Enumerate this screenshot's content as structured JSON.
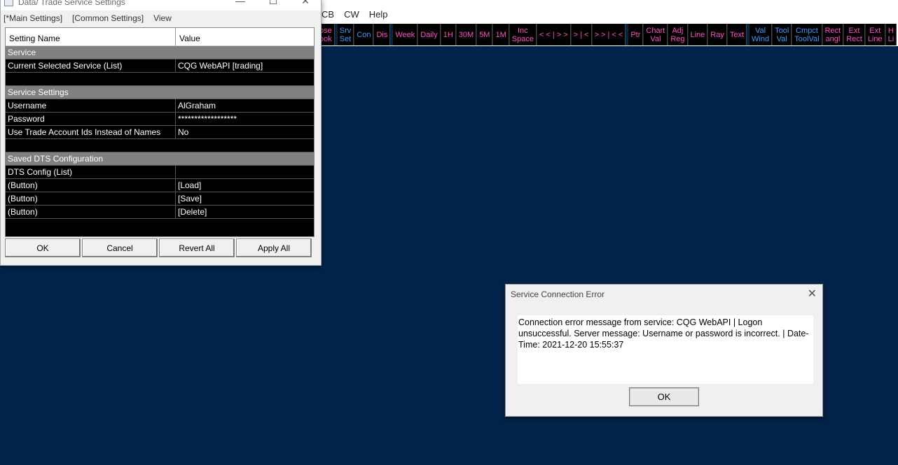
{
  "app": {
    "menu": [
      "CB",
      "CW",
      "Help"
    ],
    "toolbar": [
      {
        "label": "ose\nook",
        "color": "pink"
      },
      {
        "label": "Srv\nSet",
        "color": "blue"
      },
      {
        "label": "Con",
        "color": "blue"
      },
      {
        "label": "Dis",
        "color": "pink"
      },
      {
        "label": "Week",
        "color": "pink"
      },
      {
        "label": "Daily",
        "color": "pink"
      },
      {
        "label": "1H",
        "color": "pink"
      },
      {
        "label": "30M",
        "color": "pink"
      },
      {
        "label": "5M",
        "color": "pink"
      },
      {
        "label": "1M",
        "color": "pink"
      },
      {
        "label": "Inc\nSpace",
        "color": "pink"
      },
      {
        "label": "< < | > >",
        "color": "pink"
      },
      {
        "label": "> | <",
        "color": "pink"
      },
      {
        "label": "> > | < <",
        "color": "pink"
      },
      {
        "label": "Ptr",
        "color": "pink"
      },
      {
        "label": "Chart\nVal",
        "color": "pink"
      },
      {
        "label": "Adj\nReg",
        "color": "pink"
      },
      {
        "label": "Line",
        "color": "pink"
      },
      {
        "label": "Ray",
        "color": "pink"
      },
      {
        "label": "Text",
        "color": "pink"
      },
      {
        "label": "Val\nWind",
        "color": "blue"
      },
      {
        "label": "Tool\nVal",
        "color": "blue"
      },
      {
        "label": "Cmpct\nToolVal",
        "color": "blue"
      },
      {
        "label": "Rect\nangl",
        "color": "pink"
      },
      {
        "label": "Ext\nRect",
        "color": "pink"
      },
      {
        "label": "Ext\nLine",
        "color": "pink"
      },
      {
        "label": "H\nLi",
        "color": "pink"
      }
    ]
  },
  "settings_window": {
    "title": "Data/ Trade Service Settings",
    "menu": [
      "[*Main Settings]",
      "[Common Settings]",
      "View"
    ],
    "headers": {
      "name": "Setting Name",
      "value": "Value"
    },
    "sections": {
      "service": "Service",
      "service_settings": "Service Settings",
      "saved_dts": "Saved DTS Configuration"
    },
    "rows": {
      "current_service": {
        "name": "Current Selected Service (List)",
        "value": "CQG WebAPI    [trading]"
      },
      "username": {
        "name": "Username",
        "value": "AlGraham"
      },
      "password": {
        "name": "Password",
        "value": "******************"
      },
      "use_trade_ids": {
        "name": "Use Trade Account Ids Instead of Names",
        "value": "No"
      },
      "dts_config": {
        "name": "DTS Config (List)",
        "value": ""
      },
      "load": {
        "name": " (Button)",
        "value": "[Load]"
      },
      "save": {
        "name": " (Button)",
        "value": "[Save]"
      },
      "delete": {
        "name": " (Button)",
        "value": "[Delete]"
      }
    },
    "buttons": {
      "ok": "OK",
      "cancel": "Cancel",
      "revert_all": "Revert All",
      "apply_all": "Apply All"
    }
  },
  "error_dialog": {
    "title": "Service Connection Error",
    "message": "Connection error message from service: CQG WebAPI | Logon unsuccessful. Server message: Username or password is incorrect. | Date-Time: 2021-12-20  15:55:37",
    "ok": "OK"
  },
  "colors": {
    "background": "#03244a",
    "pink": "#ff4fc4",
    "blue": "#3b9bff"
  }
}
